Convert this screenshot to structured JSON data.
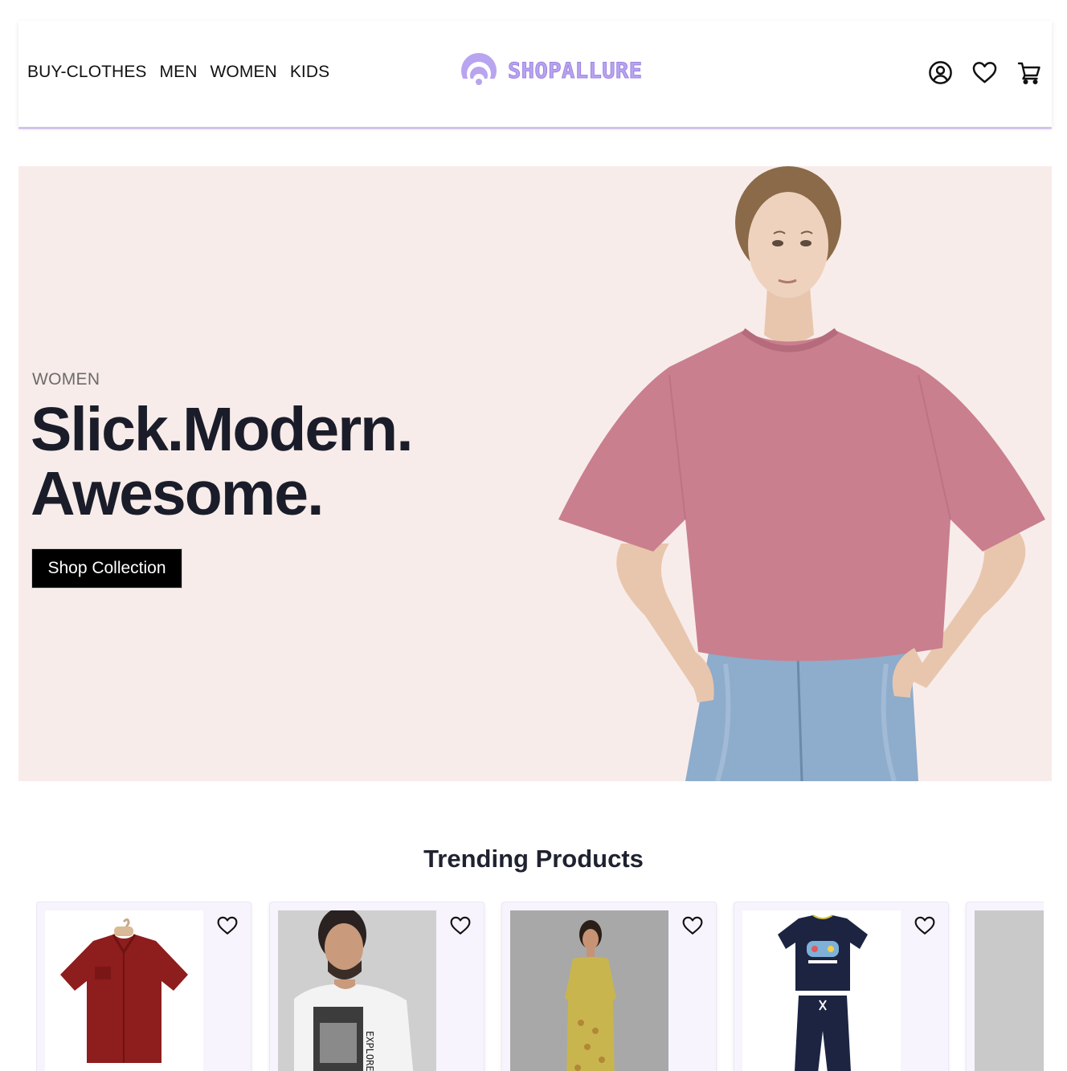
{
  "header": {
    "nav": [
      "BUY-CLOTHES",
      "MEN",
      "WOMEN",
      "KIDS"
    ],
    "brand": "SHOPALLURE",
    "icons": [
      "account-icon",
      "heart-icon",
      "cart-icon"
    ]
  },
  "hero": {
    "eyebrow": "WOMEN",
    "title_line1": "Slick.Modern.",
    "title_line2": "Awesome.",
    "cta": "Shop Collection"
  },
  "trending": {
    "title": "Trending Products",
    "products": [
      {
        "image": "red-shirt"
      },
      {
        "image": "man-white-tshirt"
      },
      {
        "image": "woman-yellow-kurta"
      },
      {
        "image": "kids-navy-set"
      },
      {
        "image": "partial-product"
      }
    ]
  },
  "colors": {
    "brand": "#b8a4ef",
    "hero_bg": "#f8ecea",
    "cta_bg": "#000000",
    "card_bg": "#f7f4fd"
  }
}
